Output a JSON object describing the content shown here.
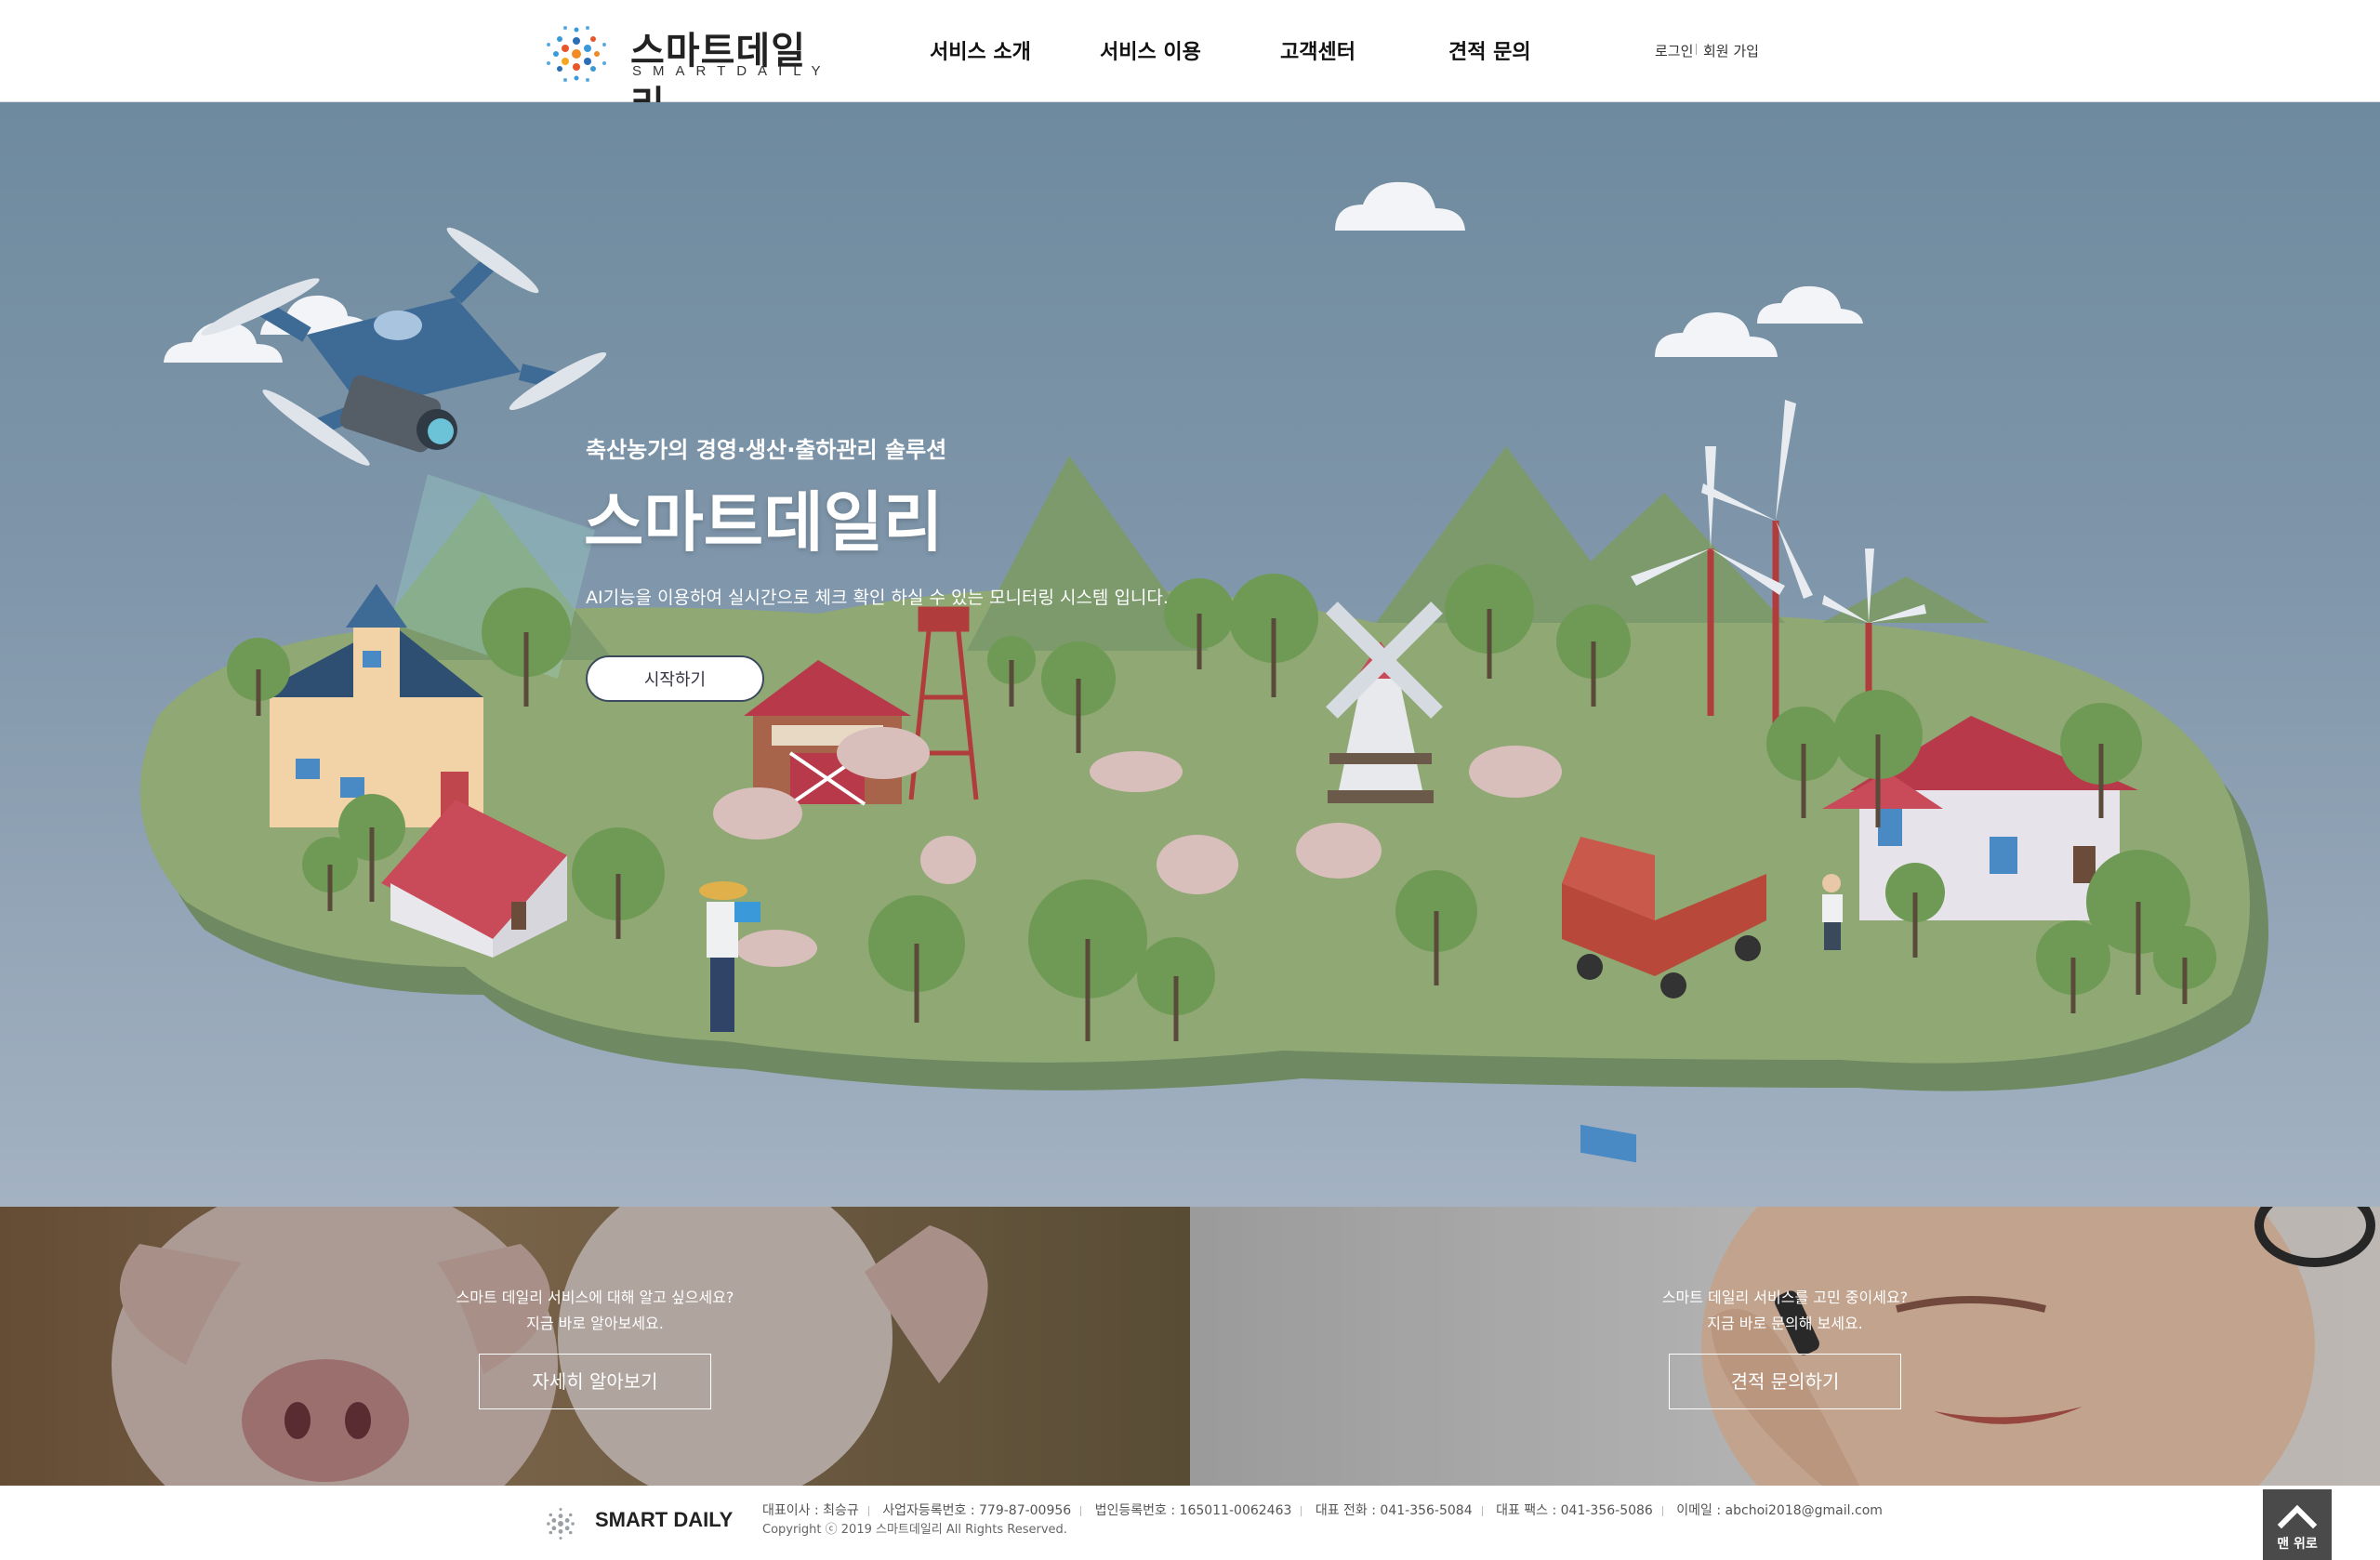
{
  "header": {
    "logo_text": "스마트데일리",
    "logo_sub": "SMARTDAILY",
    "nav": [
      {
        "label": "서비스 소개"
      },
      {
        "label": "서비스 이용"
      },
      {
        "label": "고객센터"
      },
      {
        "label": "견적 문의"
      }
    ],
    "login": "로그인",
    "signup": "회원 가입"
  },
  "hero": {
    "subtitle": "축산농가의 경영·생산·출하관리 솔루션",
    "title": "스마트데일리",
    "description": "AI기능을 이용하여 실시간으로 체크 확인 하실 수 있는 모니터링 시스템 입니다.",
    "button": "시작하기"
  },
  "promo": {
    "left": {
      "line1": "스마트 데일리 서비스에 대해 알고 싶으세요?",
      "line2": "지금 바로 알아보세요.",
      "button": "자세히 알아보기"
    },
    "right": {
      "line1": "스마트 데일리 서비스를 고민 중이세요?",
      "line2": "지금 바로 문의해 보세요.",
      "button": "견적 문의하기"
    }
  },
  "footer": {
    "logo_text": "SMART DAILY",
    "ceo": "대표이사 : 최승규",
    "business_no": "사업자등록번호 : 779-87-00956",
    "corp_no": "법인등록번호 : 165011-0062463",
    "phone": "대표 전화 : 041-356-5084",
    "fax": "대표 팩스 : 041-356-5086",
    "email": "이메일 : abchoi2018@gmail.com",
    "copyright": "Copyright ⓒ 2019 스마트데일리 All Rights Reserved.",
    "top_button": "맨 위로"
  },
  "colors": {
    "hero_sky": "#7b93a8",
    "ground": "#8fa874",
    "roof_red": "#b83a4a",
    "drone_blue": "#3d6b96"
  }
}
